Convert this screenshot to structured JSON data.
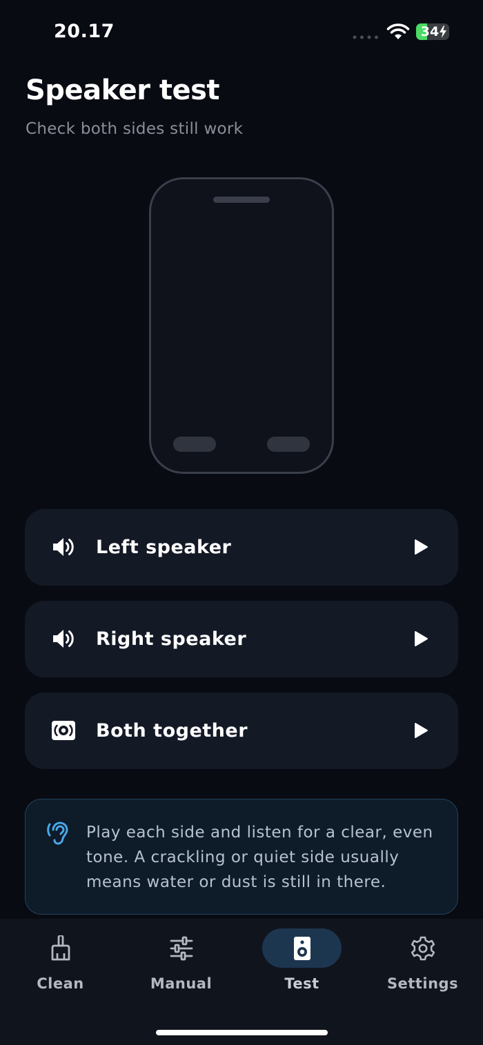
{
  "status_bar": {
    "time": "20.17",
    "battery_level": "34",
    "battery_fraction": 0.34,
    "battery_color": "#4cd964"
  },
  "header": {
    "title": "Speaker test",
    "subtitle": "Check both sides still work"
  },
  "speakers": [
    {
      "label": "Left speaker",
      "icon": "speaker-volume-icon",
      "action_icon": "play-icon"
    },
    {
      "label": "Right speaker",
      "icon": "speaker-volume-icon",
      "action_icon": "play-icon"
    },
    {
      "label": "Both together",
      "icon": "surround-speaker-icon",
      "action_icon": "play-icon"
    }
  ],
  "info": {
    "icon": "ear-icon",
    "text": "Play each side and listen for a clear, even tone. A crackling or quiet side usually means water or dust is still in there."
  },
  "tabs": [
    {
      "label": "Clean",
      "icon": "broom-icon",
      "active": false
    },
    {
      "label": "Manual",
      "icon": "sliders-icon",
      "active": false
    },
    {
      "label": "Test",
      "icon": "speaker-icon",
      "active": true
    },
    {
      "label": "Settings",
      "icon": "gear-icon",
      "active": false
    }
  ],
  "colors": {
    "background": "#080b12",
    "card": "#141926",
    "accent": "#4aa8e8",
    "active_tab_pill": "#1d3650"
  }
}
